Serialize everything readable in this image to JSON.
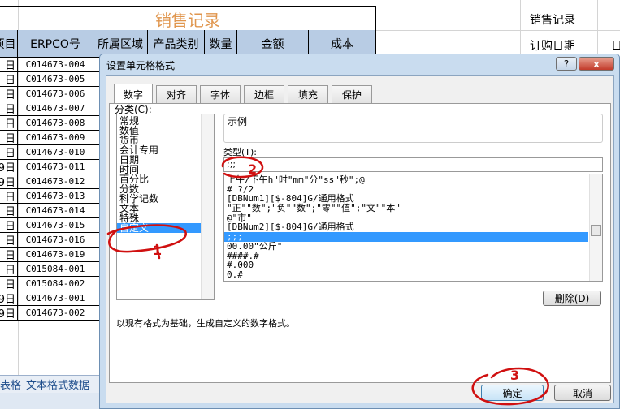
{
  "sheet": {
    "title": "销售记录",
    "headers": [
      "项目",
      "ERPCO号",
      "所属区域",
      "产品类别",
      "数量",
      "金额",
      "成本"
    ],
    "rows": [
      {
        "date": "日",
        "code": "C014673-004"
      },
      {
        "date": "日",
        "code": "C014673-005"
      },
      {
        "date": "日",
        "code": "C014673-006"
      },
      {
        "date": "日",
        "code": "C014673-007"
      },
      {
        "date": "日",
        "code": "C014673-008"
      },
      {
        "date": "日",
        "code": "C014673-009"
      },
      {
        "date": "日",
        "code": "C014673-010"
      },
      {
        "date": "9日",
        "code": "C014673-011"
      },
      {
        "date": "9日",
        "code": "C014673-012"
      },
      {
        "date": "日",
        "code": "C014673-013"
      },
      {
        "date": "日",
        "code": "C014673-014"
      },
      {
        "date": "日",
        "code": "C014673-015"
      },
      {
        "date": "日",
        "code": "C014673-016"
      },
      {
        "date": "日",
        "code": "C014673-019"
      },
      {
        "date": "日",
        "code": "C015084-001"
      },
      {
        "date": "日",
        "code": "C015084-002"
      },
      {
        "date": "9日",
        "code": "C014673-001"
      },
      {
        "date": "9日",
        "code": "C014673-002"
      }
    ],
    "right_cells": [
      "销售记录",
      "订购日期",
      "日"
    ],
    "sheet_tabs": [
      "表格",
      "文本格式数据"
    ]
  },
  "dialog": {
    "title": "设置单元格格式",
    "help": "?",
    "close": "x",
    "tabs": [
      "数字",
      "对齐",
      "字体",
      "边框",
      "填充",
      "保护"
    ],
    "category_label": "分类(C):",
    "categories": [
      "常规",
      "数值",
      "货币",
      "会计专用",
      "日期",
      "时间",
      "百分比",
      "分数",
      "科学记数",
      "文本",
      "特殊",
      "自定义"
    ],
    "selected_category": "自定义",
    "sample_label": "示例",
    "type_label": "类型(T):",
    "type_value": ";;;",
    "formats": [
      "上午/下午h\"时\"mm\"分\"ss\"秒\";@",
      "# ?/2",
      "[DBNum1][$-804]G/通用格式",
      "\"正\"\"数\";\"负\"\"数\";\"零\"\"值\";\"文\"\"本\"",
      "@\"市\"",
      "[DBNum2][$-804]G/通用格式",
      ";;;",
      "00.00\"公斤\"",
      "####.#",
      "#.000",
      "0.#"
    ],
    "selected_format": ";;;",
    "delete_button": "删除(D)",
    "description": "以现有格式为基础，生成自定义的数字格式。",
    "ok": "确定",
    "cancel": "取消"
  },
  "annotations": [
    "1",
    "2",
    "3"
  ],
  "colors": {
    "title": "#e0964e",
    "header": "#b8cce4",
    "selection": "#3399ff",
    "annotation": "#d01010"
  }
}
